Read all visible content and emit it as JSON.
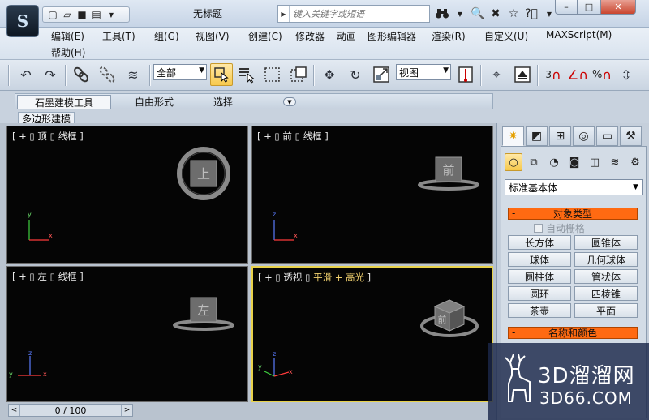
{
  "titlebar": {
    "logo": "S",
    "window_title": "无标题",
    "search_placeholder": "键入关键字或短语",
    "quick_access": [
      "new-icon",
      "open-icon",
      "save-icon",
      "project-folder-icon",
      "dropdown-icon"
    ],
    "info_tools": [
      "binoculars-icon",
      "subscription-icon",
      "star-icon",
      "help-icon"
    ],
    "controls": {
      "minimize": "–",
      "maximize": "□",
      "close": "✕"
    }
  },
  "menu": {
    "items": [
      "编辑(E)",
      "工具(T)",
      "组(G)",
      "视图(V)",
      "创建(C)",
      "修改器",
      "动画",
      "图形编辑器",
      "渲染(R)",
      "自定义(U)",
      "MAXScript(M)",
      "帮助(H)"
    ]
  },
  "toolbar": {
    "selection_filter": "全部",
    "ref_coord_system": "视图",
    "icons": [
      "undo-icon",
      "redo-icon",
      "link-icon",
      "unlink-icon",
      "bind-space-warp-icon",
      "select-object-icon",
      "select-by-name-icon",
      "rect-selection-icon",
      "window-crossing-icon",
      "move-icon",
      "rotate-icon",
      "scale-icon",
      "mirror-icon",
      "align-icon",
      "pivot-icon",
      "snap-3d-icon",
      "angle-snap-icon",
      "percent-snap-icon",
      "spinner-snap-icon"
    ]
  },
  "ribbon": {
    "tabs": [
      "石墨建模工具",
      "自由形式",
      "选择"
    ],
    "panel_label": "多边形建模"
  },
  "viewports": {
    "top": {
      "bracket_open": "[ + ▯ ",
      "name": "顶",
      "sep": " ▯ ",
      "shading": "线框",
      "bracket_close": " ]",
      "cube_label": "上"
    },
    "front": {
      "bracket_open": "[ + ▯ ",
      "name": "前",
      "sep": " ▯ ",
      "shading": "线框",
      "bracket_close": " ]",
      "cube_label": "前"
    },
    "left": {
      "bracket_open": "[ + ▯ ",
      "name": "左",
      "sep": " ▯ ",
      "shading": "线框",
      "bracket_close": " ]",
      "cube_label": "左"
    },
    "perspective": {
      "bracket_open": "[ + ▯ ",
      "name": "透视",
      "sep": " ▯ ",
      "shading": "平滑 + 高光",
      "bracket_close": " ]",
      "cube_label": "前"
    },
    "axis": {
      "x": "x",
      "y": "y",
      "z": "z"
    },
    "active_border_color": "#e8d24a"
  },
  "command_panel": {
    "tabs": [
      "create-icon",
      "modify-icon",
      "hierarchy-icon",
      "motion-icon",
      "display-icon",
      "utilities-icon"
    ],
    "categories": [
      "geometry-icon",
      "shapes-icon",
      "lights-icon",
      "cameras-icon",
      "helpers-icon",
      "spacewarps-icon",
      "systems-icon"
    ],
    "subtype": "标准基本体",
    "rollout_object_type": "对象类型",
    "autogrid_label": "自动栅格",
    "objects": [
      [
        "长方体",
        "圆锥体"
      ],
      [
        "球体",
        "几何球体"
      ],
      [
        "圆柱体",
        "管状体"
      ],
      [
        "圆环",
        "四棱锥"
      ],
      [
        "茶壶",
        "平面"
      ]
    ],
    "rollout_name_color": "名称和颜色",
    "rollout_header_color": "#ff6a12"
  },
  "time_slider": {
    "label": "0 / 100",
    "prev": "<",
    "next": ">"
  },
  "watermark": {
    "brand": "3D溜溜网",
    "site": "3D66.COM"
  }
}
